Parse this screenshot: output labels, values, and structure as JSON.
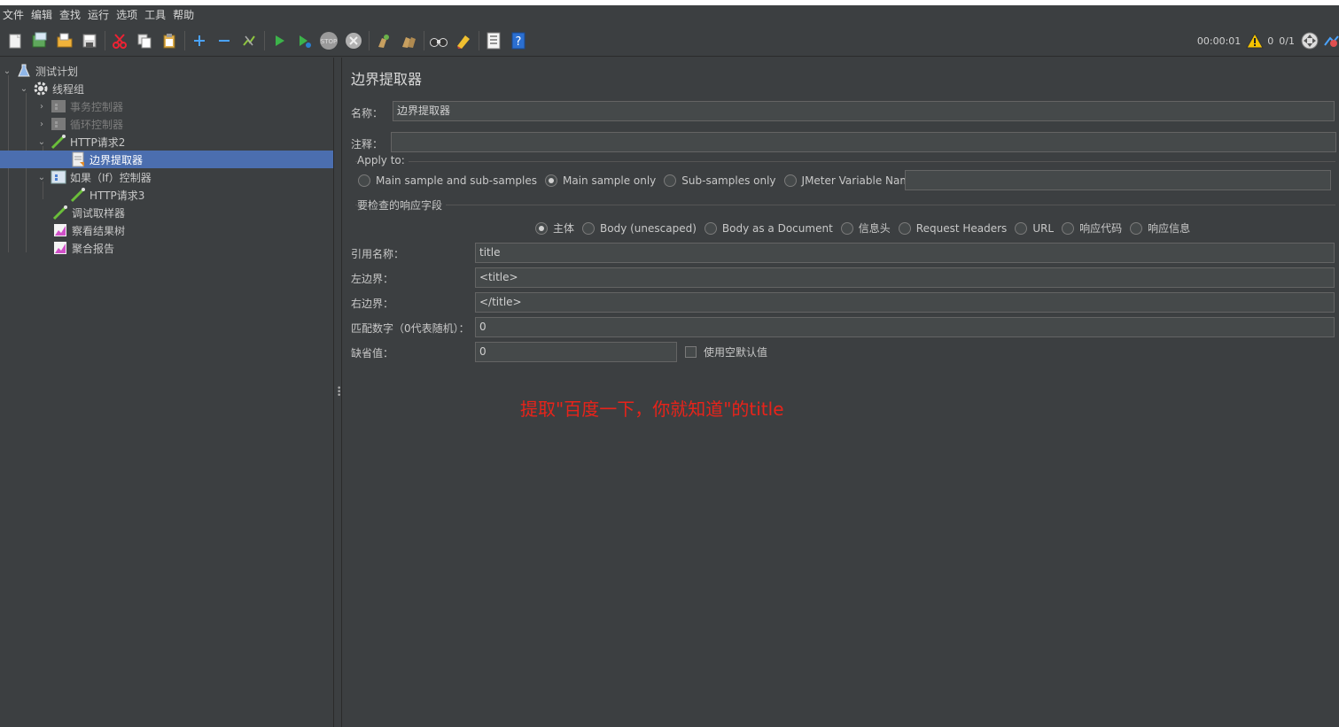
{
  "menu": [
    "文件",
    "编辑",
    "查找",
    "运行",
    "选项",
    "工具",
    "帮助"
  ],
  "toolbar": {
    "icons": [
      "new-icon",
      "templates-icon",
      "open-icon",
      "save-icon",
      "cut-icon",
      "copy-icon",
      "paste-icon",
      "expand-icon",
      "collapse-icon",
      "toggle-icon",
      "start-icon",
      "start-no-pause-icon",
      "stop-icon",
      "shutdown-icon",
      "clear-icon",
      "clear-all-icon",
      "search-icon",
      "reset-search-icon",
      "function-helper-icon",
      "help-icon"
    ],
    "timer": "00:00:01",
    "warnings": "0",
    "threads": "0/1"
  },
  "tree": {
    "items": [
      {
        "label": "测试计划",
        "icon": "test-plan-icon",
        "chevron": "down"
      },
      {
        "label": "线程组",
        "icon": "thread-group-icon",
        "chevron": "down"
      },
      {
        "label": "事务控制器",
        "icon": "transaction-controller-icon",
        "chevron": "right",
        "disabled": true
      },
      {
        "label": "循环控制器",
        "icon": "loop-controller-icon",
        "chevron": "right",
        "disabled": true
      },
      {
        "label": "HTTP请求2",
        "icon": "http-sampler-icon",
        "chevron": "down"
      },
      {
        "label": "边界提取器",
        "icon": "extractor-icon",
        "selected": true
      },
      {
        "label": "如果（If）控制器",
        "icon": "if-controller-icon",
        "chevron": "down"
      },
      {
        "label": "HTTP请求3",
        "icon": "http-sampler-icon"
      },
      {
        "label": "调试取样器",
        "icon": "debug-sampler-icon"
      },
      {
        "label": "察看结果树",
        "icon": "listener-icon"
      },
      {
        "label": "聚合报告",
        "icon": "listener-icon"
      }
    ]
  },
  "panel": {
    "title": "边界提取器",
    "name_label": "名称：",
    "name_value": "边界提取器",
    "comment_label": "注释：",
    "comment_value": "",
    "apply_to_title": "Apply to:",
    "apply_options": [
      "Main sample and sub-samples",
      "Main sample only",
      "Sub-samples only",
      "JMeter Variable Name to use"
    ],
    "apply_selected": 1,
    "jmeter_var_value": "",
    "field_title": "要检查的响应字段",
    "field_options": [
      "主体",
      "Body (unescaped)",
      "Body as a Document",
      "信息头",
      "Request Headers",
      "URL",
      "响应代码",
      "响应信息"
    ],
    "field_selected": 0,
    "ref_label": "引用名称：",
    "ref_value": "title",
    "left_label": "左边界：",
    "left_value": "<title>",
    "right_label": "右边界：",
    "right_value": "</title>",
    "match_label": "匹配数字（0代表随机）：",
    "match_value": "0",
    "default_label": "缺省值：",
    "default_value": "0",
    "empty_default_label": "使用空默认值",
    "annotation": "提取\"百度一下，你就知道\"的title"
  },
  "colors": {
    "background": "#3c3f41",
    "selection": "#4b6eaf",
    "annotation": "#e8231a"
  }
}
